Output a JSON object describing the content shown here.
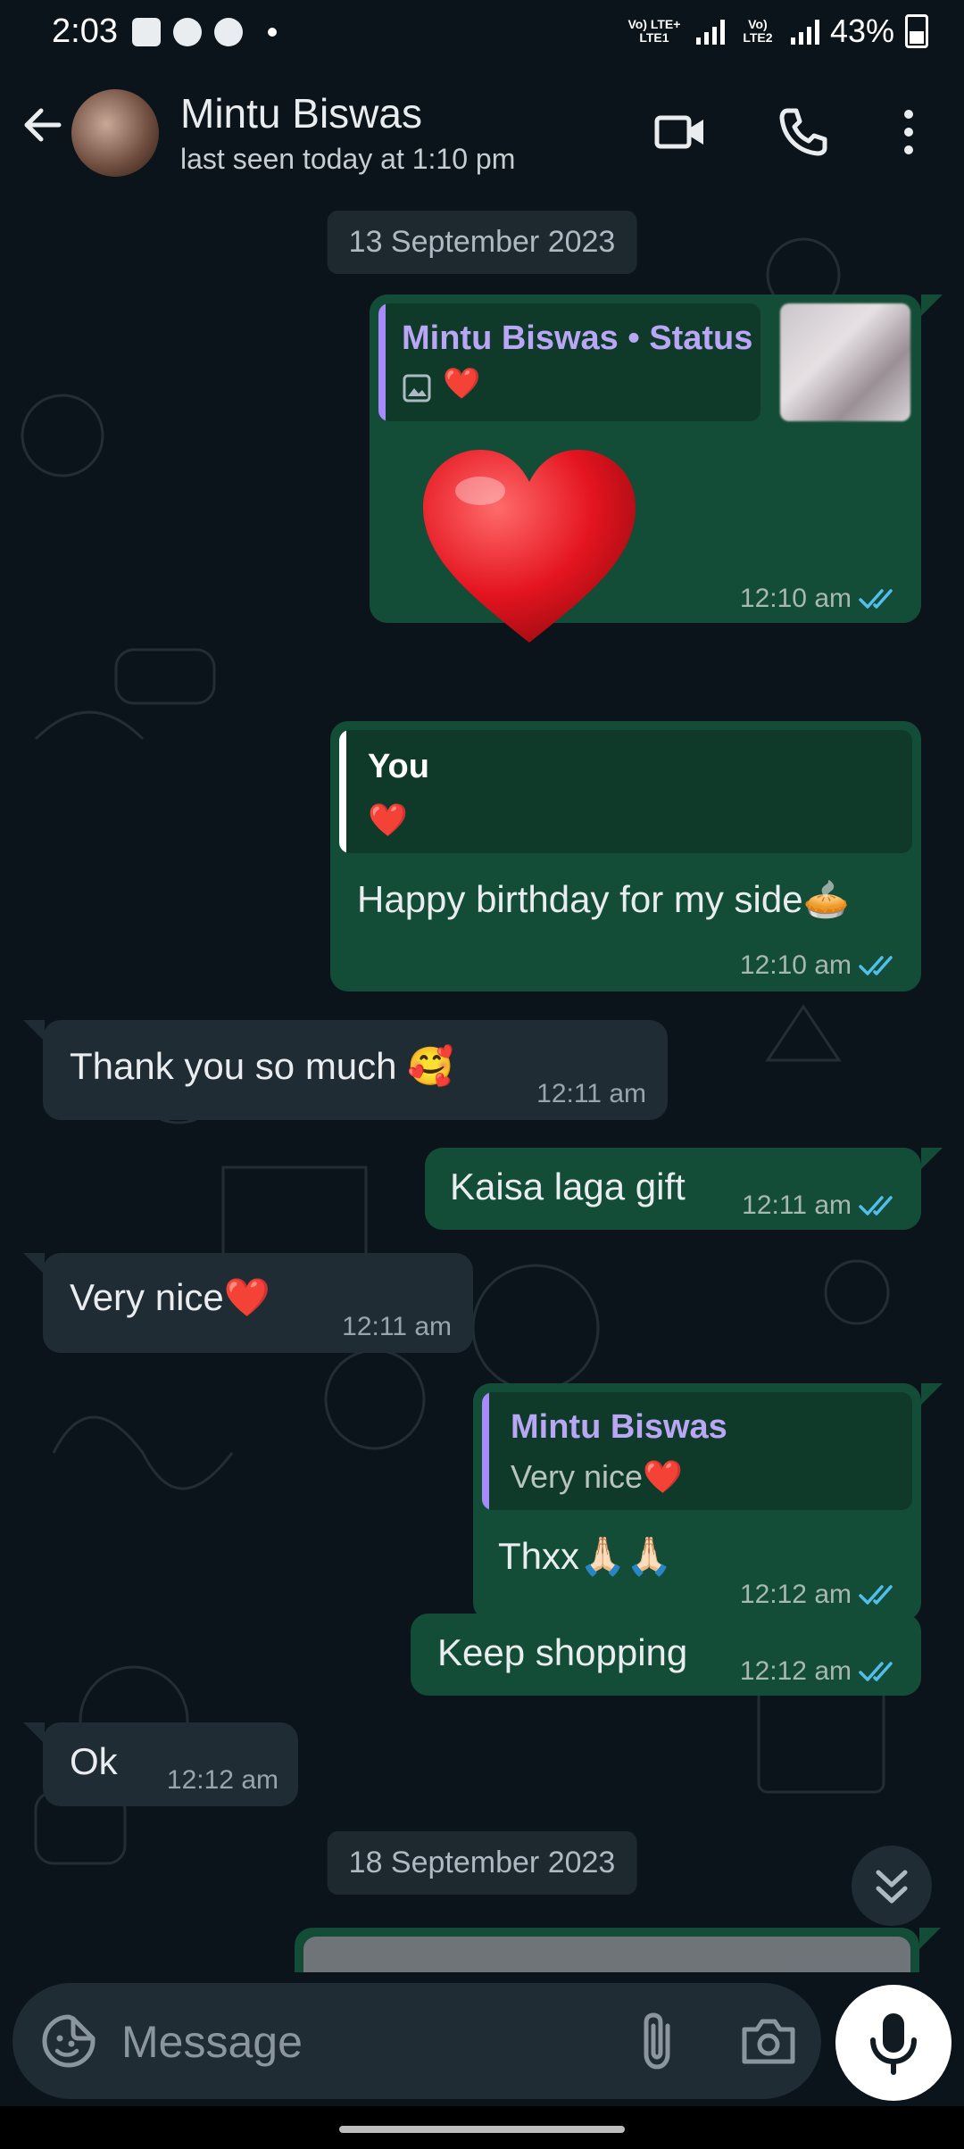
{
  "status_bar": {
    "time": "2:03",
    "sim1_label": "Vo) LTE+ LTE1",
    "sim2_label": "Vo) LTE2",
    "battery": "43%"
  },
  "header": {
    "contact_name": "Mintu Biswas",
    "last_seen": "last seen today at 1:10 pm",
    "icons": [
      "back-arrow-icon",
      "video-call-icon",
      "voice-call-icon",
      "more-options-icon"
    ]
  },
  "chat": {
    "date_1": "13 September 2023",
    "date_2": "18 September 2023",
    "messages": [
      {
        "direction": "outgoing",
        "quote_name": "Mintu Biswas • Status",
        "quote_content": "❤️",
        "text": "❤️",
        "time": "12:10 am",
        "read": true
      },
      {
        "direction": "outgoing",
        "quote_name": "You",
        "quote_content": "❤️",
        "text": "Happy birthday for my side🥧",
        "time": "12:10 am",
        "read": true
      },
      {
        "direction": "incoming",
        "text": "Thank you so much 🥰",
        "time": "12:11 am"
      },
      {
        "direction": "outgoing",
        "text": "Kaisa laga gift",
        "time": "12:11 am",
        "read": true
      },
      {
        "direction": "incoming",
        "text": "Very nice❤️",
        "time": "12:11 am"
      },
      {
        "direction": "outgoing",
        "quote_name": "Mintu Biswas",
        "quote_content": "Very nice❤️",
        "text": "Thxx🙏🏻🙏🏻",
        "time": "12:12 am",
        "read": true
      },
      {
        "direction": "outgoing",
        "text": "Keep shopping",
        "time": "12:12 am",
        "read": true
      },
      {
        "direction": "incoming",
        "text": "Ok",
        "time": "12:12 am"
      }
    ]
  },
  "input": {
    "placeholder": "Message",
    "value": ""
  },
  "colors": {
    "background": "#0b141a",
    "outgoing_bubble": "#144d37",
    "incoming_bubble": "#1f2c34",
    "read_tick": "#53bdeb",
    "status_quote_bar": "#a78bfa",
    "self_quote_bar": "#ffffff"
  }
}
